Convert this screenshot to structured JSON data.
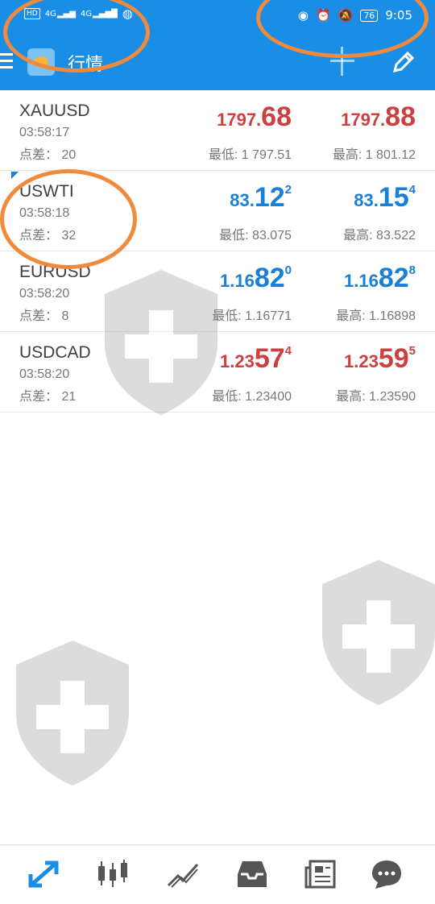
{
  "status_bar": {
    "left_badges": [
      "HD",
      "4G",
      "4G"
    ],
    "battery": "76",
    "time": "9:05",
    "icons": [
      "eye-icon",
      "alarm-icon",
      "bell-muted-icon"
    ]
  },
  "toolbar": {
    "title": "行情",
    "icons": [
      "menu-icon",
      "app-logo",
      "add-icon",
      "edit-icon"
    ]
  },
  "quotes": [
    {
      "symbol": "XAUUSD",
      "time": "03:58:17",
      "spread": "点差：  20",
      "bid": {
        "small": "1797.",
        "big": "68",
        "sup": ""
      },
      "ask": {
        "small": "1797.",
        "big": "88",
        "sup": ""
      },
      "low": "最低: 1 797.51",
      "high": "最高: 1 801.12",
      "color": "#cc4040"
    },
    {
      "symbol": "USWTI",
      "time": "03:58:18",
      "spread": "点差：  32",
      "bid": {
        "small": "83.",
        "big": "12",
        "sup": "2"
      },
      "ask": {
        "small": "83.",
        "big": "15",
        "sup": "4"
      },
      "low": "最低: 83.075",
      "high": "最高: 83.522",
      "color": "#1a7fd6"
    },
    {
      "symbol": "EURUSD",
      "time": "03:58:20",
      "spread": "点差：  8",
      "bid": {
        "small": "1.16",
        "big": "82",
        "sup": "0"
      },
      "ask": {
        "small": "1.16",
        "big": "82",
        "sup": "8"
      },
      "low": "最低: 1.16771",
      "high": "最高: 1.16898",
      "color": "#1a7fd6"
    },
    {
      "symbol": "USDCAD",
      "time": "03:58:20",
      "spread": "点差：  21",
      "bid": {
        "small": "1.23",
        "big": "57",
        "sup": "4"
      },
      "ask": {
        "small": "1.23",
        "big": "59",
        "sup": "5"
      },
      "low": "最低: 1.23400",
      "high": "最高: 1.23590",
      "color": "#cc4040"
    }
  ],
  "bottom_nav": {
    "items": [
      "quotes-icon",
      "chart-icon",
      "trade-icon",
      "history-icon",
      "news-icon",
      "chat-icon"
    ],
    "active_color": "#1a8ee6",
    "inactive_color": "#555555"
  }
}
